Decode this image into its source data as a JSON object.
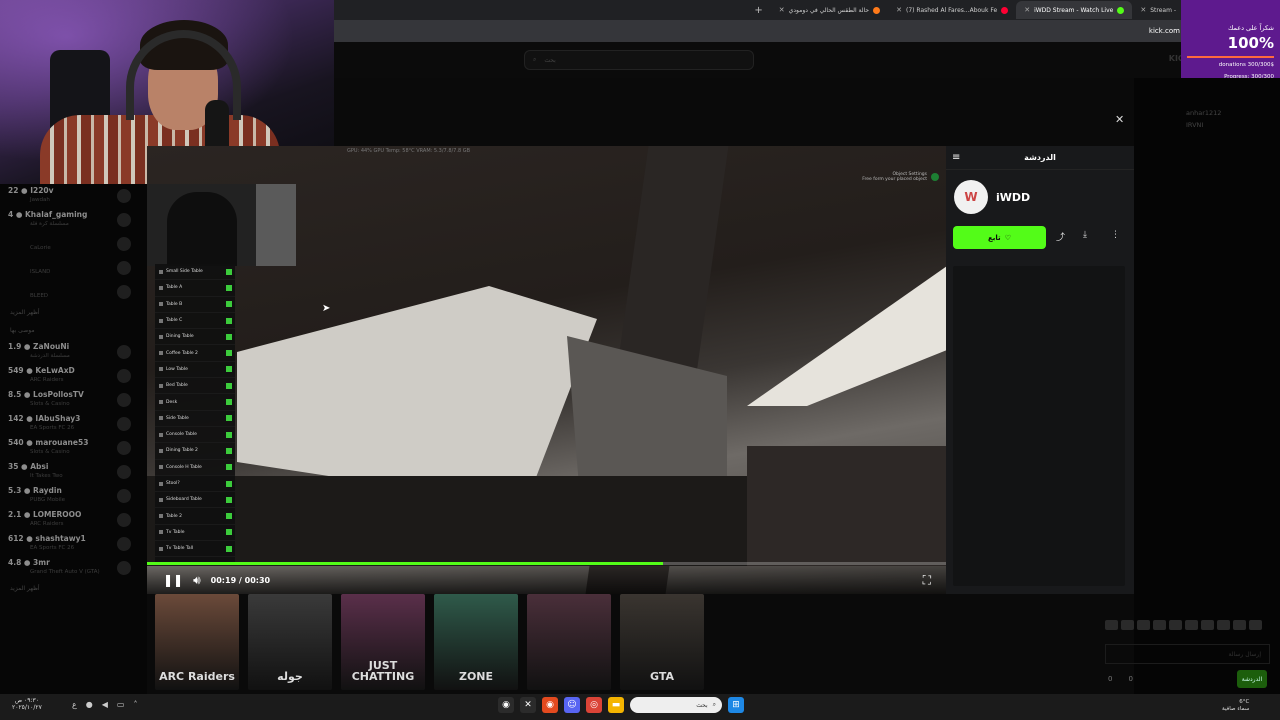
{
  "browser": {
    "tabs": [
      {
        "label": "Stream -",
        "fav_color": "#53fc18"
      },
      {
        "label": "iWDD Stream - Watch Live",
        "fav_color": "#53fc18",
        "active": true
      },
      {
        "label": "(7) Rashed Al Fares...Abouk Fe",
        "fav_color": "#ff0033"
      },
      {
        "label": "حالة الطقس الحالي في دومودي",
        "fav_color": "#ff7a1a"
      }
    ],
    "new_tab": "+",
    "url": "kick.com"
  },
  "site": {
    "search_placeholder": "بحث",
    "logo": "KICK"
  },
  "donation": {
    "title": "شكراً على دعمك",
    "percent": "100%",
    "progress_fraction": 1.0,
    "donations_line": "donations 300/300$",
    "progress_line": "Progress: 300/300"
  },
  "sidebar": {
    "items": [
      {
        "name": "22 ● I220v",
        "game": "Jawdah"
      },
      {
        "name": "4 ● Khalaf_gaming",
        "game": "مسلسلة كرة فلة"
      },
      {
        "name": "",
        "game": "CaLorie"
      },
      {
        "name": "",
        "game": "ISLAND"
      },
      {
        "name": "",
        "game": "BLEED"
      },
      {
        "header": "أظهر المزيد"
      },
      {
        "header": "موصى بها"
      },
      {
        "name": "1.9 ● ZaNouNi",
        "game": "مسلسلة الدردشة"
      },
      {
        "name": "549 ● KeLwAxD",
        "game": "ARC Raiders"
      },
      {
        "name": "8.5 ● LosPollosTV",
        "game": "Slots & Casino"
      },
      {
        "name": "142 ● IAbuShay3",
        "game": "EA Sports FC 26"
      },
      {
        "name": "540 ● marouane53",
        "game": "Slots & Casino"
      },
      {
        "name": "35 ● Absi",
        "game": "It Takes Two"
      },
      {
        "name": "5.3 ● Raydin",
        "game": "PUBG Mobile"
      },
      {
        "name": "2.1 ● LOMEROOO",
        "game": "ARC Raiders"
      },
      {
        "name": "612 ● shashtawy1",
        "game": "EA Sports FC 26"
      },
      {
        "name": "4.8 ● 3mr",
        "game": "Grand Theft Auto V (GTA)"
      },
      {
        "header": "أظهر المزيد"
      }
    ]
  },
  "video": {
    "stats": "GPU: 44%     GPU Temp: 58°C     VRAM: 5.3/7.8/7.8 GB",
    "object_settings": "Object Settings",
    "object_settings_sub": "Free form your placed object",
    "layer_panel": [
      "Small Side Table",
      "Table A",
      "Table B",
      "Table C",
      "Dining Table",
      "Coffee Table 2",
      "Low Table",
      "Bed Table",
      "Desk",
      "Side Table",
      "Console Table",
      "Dining Table 2",
      "Console H Table",
      "Stool?",
      "Sideboard Table",
      "Table 2",
      "Tv Table",
      "Tv Table Tall"
    ],
    "time": "00:19 / 00:30",
    "progress_fraction": 0.645
  },
  "chat": {
    "title": "الدردشة",
    "channel_name": "iWDD",
    "follow_label": "تابع"
  },
  "right_users": [
    {
      "label": "anhar1212"
    },
    {
      "label": "IRVNI"
    }
  ],
  "categories": [
    {
      "label": "ARC Raiders",
      "color": "#6b4a3a"
    },
    {
      "label": "جوله",
      "color": "#3a3a3a"
    },
    {
      "label": "JUST CHATTING",
      "color": "#5a2f4a"
    },
    {
      "label": "ZONE",
      "color": "#2f5a4a"
    },
    {
      "label": "",
      "color": "#4a2f3a"
    },
    {
      "label": "GTA",
      "color": "#3a3530"
    }
  ],
  "chat_input": {
    "placeholder": "إرسال رسالة",
    "send_label": "الدردشة",
    "viewers": "0",
    "count2": "0"
  },
  "taskbar": {
    "clock_time": "٠٩:٣٠ ص",
    "clock_date": "٢٠٢٥/١٠/٢٧",
    "lang": "ع",
    "search_placeholder": "بحث",
    "weather_temp": "6°C",
    "weather_desc": "سماء صافية"
  }
}
